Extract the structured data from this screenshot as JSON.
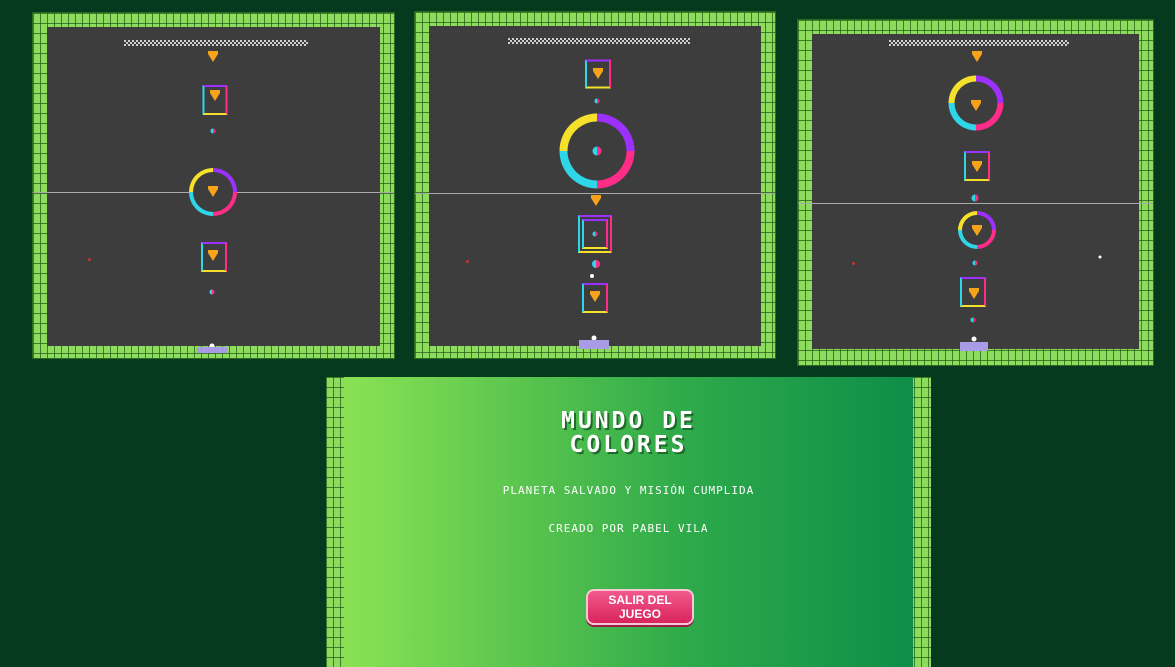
{
  "credits": {
    "title_line1": "MUNDO DE",
    "title_line2": "COLORES",
    "subtitle": "PLANETA SALVADO Y MISIÓN CUMPLIDA",
    "author": "CREADO POR PABEL VILA",
    "exit_button": "SALIR DEL JUEGO"
  },
  "colors": {
    "background": "#063a1f",
    "brick": "#8ddc5e",
    "arena": "#3d3d3d",
    "purple": "#9b30ff",
    "magenta": "#ff2d87",
    "cyan": "#2ed6e8",
    "yellow": "#f5e12b",
    "gem": "#f7a21b",
    "pad": "#a99be6"
  },
  "icons": [
    "gem-icon",
    "color-switcher-icon",
    "player-ball-icon"
  ]
}
